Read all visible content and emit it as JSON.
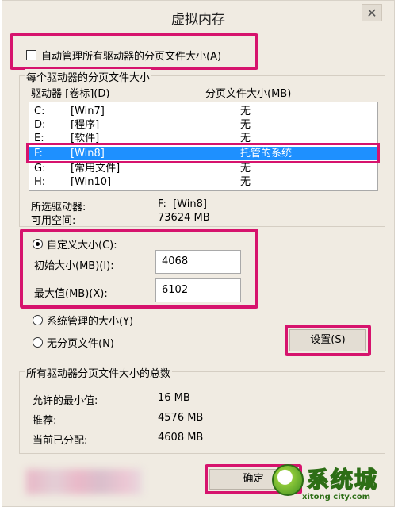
{
  "dialog": {
    "title": "虚拟内存",
    "close_glyph": "✕"
  },
  "auto_manage": {
    "label": "自动管理所有驱动器的分页文件大小(A)",
    "checked": false
  },
  "per_drive": {
    "group_label": "每个驱动器的分页文件大小",
    "headers": {
      "drive": "驱动器 [卷标](D)",
      "size": "分页文件大小(MB)"
    },
    "rows": [
      {
        "drive": "C:",
        "label": "[Win7]",
        "size": "无",
        "selected": false
      },
      {
        "drive": "D:",
        "label": "[程序]",
        "size": "无",
        "selected": false
      },
      {
        "drive": "E:",
        "label": "[软件]",
        "size": "无",
        "selected": false
      },
      {
        "drive": "F:",
        "label": "[Win8]",
        "size": "托管的系统",
        "selected": true
      },
      {
        "drive": "G:",
        "label": "[常用文件]",
        "size": "无",
        "selected": false
      },
      {
        "drive": "H:",
        "label": "[Win10]",
        "size": "无",
        "selected": false
      }
    ],
    "selected_drive_label": "所选驱动器:",
    "selected_drive_value": "F:  [Win8]",
    "free_space_label": "可用空间:",
    "free_space_value": "73624 MB"
  },
  "size_options": {
    "custom_label": "自定义大小(C):",
    "custom_selected": true,
    "initial_label": "初始大小(MB)(I):",
    "initial_value": "4068",
    "max_label": "最大值(MB)(X):",
    "max_value": "6102",
    "system_managed_label": "系统管理的大小(Y)",
    "no_paging_label": "无分页文件(N)",
    "set_button": "设置(S)"
  },
  "totals": {
    "group_label": "所有驱动器分页文件大小的总数",
    "min_label": "允许的最小值:",
    "min_value": "16 MB",
    "recommended_label": "推荐:",
    "recommended_value": "4576 MB",
    "allocated_label": "当前已分配:",
    "allocated_value": "4608 MB"
  },
  "footer": {
    "ok_button": "确定",
    "watermark_text": "系统城",
    "watermark_url": "xitong city.com"
  },
  "colors": {
    "highlight": "#d6136d",
    "selection": "#1e90ff",
    "dialog_bg": "#f0ebe2"
  }
}
